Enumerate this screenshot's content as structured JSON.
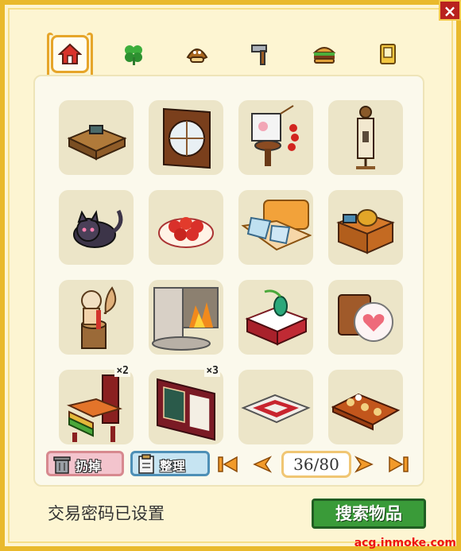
{
  "window": {
    "close_label": "×"
  },
  "tabs": [
    {
      "icon": "house-icon",
      "active": true
    },
    {
      "icon": "clover-icon",
      "active": false
    },
    {
      "icon": "chestnut-icon",
      "active": false
    },
    {
      "icon": "hammer-icon",
      "active": false
    },
    {
      "icon": "burger-icon",
      "active": false
    },
    {
      "icon": "book-icon",
      "active": false
    }
  ],
  "items": [
    {
      "icon": "tv-cabinet-icon",
      "count": ""
    },
    {
      "icon": "round-window-screen-icon",
      "count": ""
    },
    {
      "icon": "lantern-stand-icon",
      "count": ""
    },
    {
      "icon": "hanging-scroll-lamp-icon",
      "count": ""
    },
    {
      "icon": "black-cat-icon",
      "count": ""
    },
    {
      "icon": "fruit-bowl-icon",
      "count": ""
    },
    {
      "icon": "cushion-sofa-icon",
      "count": ""
    },
    {
      "icon": "kettle-stove-icon",
      "count": ""
    },
    {
      "icon": "squirrel-stump-icon",
      "count": ""
    },
    {
      "icon": "stone-fireplace-icon",
      "count": ""
    },
    {
      "icon": "vase-table-icon",
      "count": ""
    },
    {
      "icon": "heart-cushions-icon",
      "count": ""
    },
    {
      "icon": "stacked-cushion-chair-icon",
      "count": "×2"
    },
    {
      "icon": "lattice-window-icon",
      "count": "×3"
    },
    {
      "icon": "patterned-rug-icon",
      "count": ""
    },
    {
      "icon": "food-tray-icon",
      "count": ""
    }
  ],
  "toolbar": {
    "discard_label": "扔掉",
    "sort_label": "整理",
    "page_current": 36,
    "page_total": 80,
    "page_text": "36/80"
  },
  "footer": {
    "trade_status": "交易密码已设置",
    "search_label": "搜索物品"
  },
  "watermark": "acg.inmoke.com",
  "colors": {
    "frame": "#e9b92c",
    "panel": "#fbf9ec",
    "slot": "#ece5c8",
    "search_button": "#3a9b39",
    "close_button": "#b9221e"
  }
}
